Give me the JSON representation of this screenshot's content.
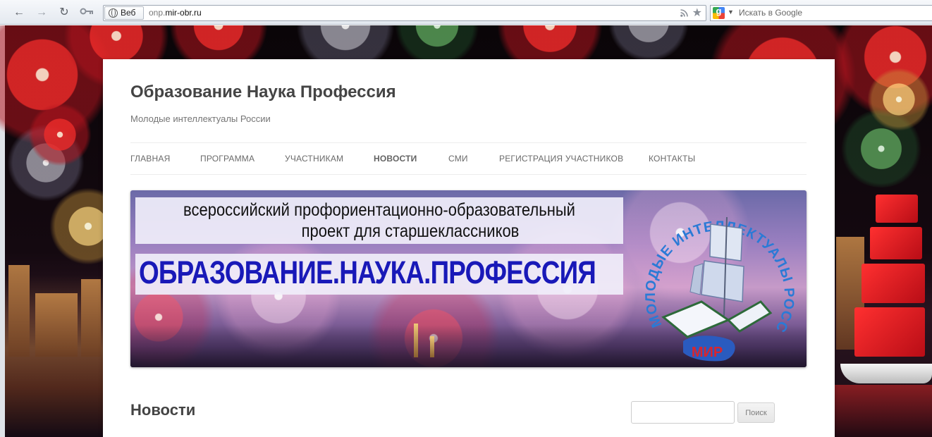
{
  "browser": {
    "chip_label": "Веб",
    "url_prefix": "onp.",
    "url_host": "mir-obr.ru",
    "search_placeholder": "Искать в Google"
  },
  "site": {
    "title": "Образование Наука Профессия",
    "tagline": "Молодые интеллектуалы России",
    "nav": [
      {
        "label": "ГЛАВНАЯ"
      },
      {
        "label": "ПРОГРАММА"
      },
      {
        "label": "УЧАСТНИКАМ"
      },
      {
        "label": "НОВОСТИ"
      },
      {
        "label": "СМИ"
      },
      {
        "label": "РЕГИСТРАЦИЯ УЧАСТНИКОВ"
      },
      {
        "label": "КОНТАКТЫ"
      }
    ],
    "active_nav": "НОВОСТИ",
    "banner": {
      "line1": "всероссийский профориентационно-образовательный",
      "line2": "проект для старшеклассников",
      "headline": "ОБРАЗОВАНИЕ.НАУКА.ПРОФЕССИЯ",
      "logo_ring_text": "МОЛОДЫЕ ИНТЕЛЛЕКТУАЛЫ РОССИИ",
      "logo_badge": "МИР"
    },
    "page_heading": "Новости",
    "search_field_value": "",
    "search_button": "Поиск"
  },
  "colors": {
    "headline_blue": "#1919b8",
    "logo_ring_blue": "#2a7ad6",
    "logo_badge_red": "#d8262e"
  }
}
